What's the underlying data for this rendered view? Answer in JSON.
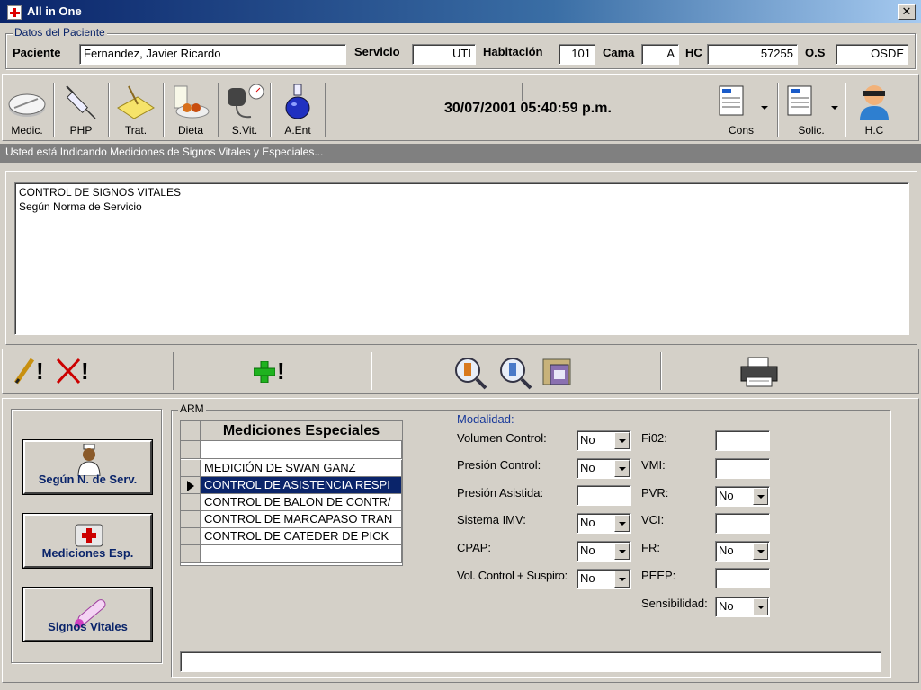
{
  "window": {
    "title": "All in One",
    "close_glyph": "✕"
  },
  "patient": {
    "legend": "Datos del Paciente",
    "paciente_label": "Paciente",
    "paciente_value": "Fernandez, Javier Ricardo",
    "servicio_label": "Servicio",
    "servicio_value": "UTI",
    "habitacion_label": "Habitación",
    "habitacion_value": "101",
    "cama_label": "Cama",
    "cama_value": "A",
    "hc_label": "HC",
    "hc_value": "57255",
    "os_label": "O.S",
    "os_value": "OSDE"
  },
  "toolbar": {
    "items": [
      {
        "label": "Medic.",
        "icon": "pill-icon"
      },
      {
        "label": "PHP",
        "icon": "syringe-icon"
      },
      {
        "label": "Trat.",
        "icon": "treatment-icon"
      },
      {
        "label": "Dieta",
        "icon": "diet-icon"
      },
      {
        "label": "S.Vit.",
        "icon": "blood-pressure-icon"
      },
      {
        "label": "A.Ent",
        "icon": "flask-icon"
      }
    ],
    "datetime": "30/07/2001 05:40:59 p.m.",
    "right_items": [
      {
        "label": "Cons",
        "icon": "document-icon"
      },
      {
        "label": "Solic.",
        "icon": "request-document-icon"
      },
      {
        "label": "H.C",
        "icon": "doctor-avatar-icon"
      }
    ]
  },
  "status": {
    "text": "Usted está Indicando Mediciones de Signos Vitales y Especiales..."
  },
  "memo": {
    "line1": "CONTROL DE SIGNOS VITALES",
    "line2": "Según Norma de Servicio"
  },
  "action_bar": {
    "edit_icon": "pencil-icon",
    "delete_icon": "delete-x-icon",
    "add_icon": "green-plus-icon",
    "search_icons": [
      "search-info-icon",
      "search-info-alt-icon"
    ],
    "folder_icon": "folder-icon",
    "print_icon": "printer-icon",
    "bang": "!"
  },
  "left_buttons": [
    {
      "label": "Según N. de Serv.",
      "icon": "nurse-icon"
    },
    {
      "label": "Mediciones Esp.",
      "icon": "first-aid-kit-icon"
    },
    {
      "label": "Signos Vitales",
      "icon": "thermometer-icon"
    }
  ],
  "arm": {
    "legend": "ARM",
    "grid_header": "Mediciones Especiales",
    "rows": [
      "",
      "MEDICIÓN DE SWAN GANZ",
      "CONTROL DE ASISTENCIA RESPI",
      "CONTROL DE BALON DE CONTR/",
      "CONTROL DE MARCAPASO TRAN",
      "CONTROL DE CATEDER DE PICK",
      ""
    ],
    "selected_row": 2,
    "modalidad_label": "Modalidad:",
    "left_fields": [
      {
        "label": "Volumen Control:",
        "type": "combo",
        "value": "No"
      },
      {
        "label": "Presión Control:",
        "type": "combo",
        "value": "No"
      },
      {
        "label": "Presión Asistida:",
        "type": "text",
        "value": ""
      },
      {
        "label": "Sistema IMV:",
        "type": "combo",
        "value": "No"
      },
      {
        "label": "CPAP:",
        "type": "combo",
        "value": "No"
      },
      {
        "label": "Vol. Control + Suspiro:",
        "type": "combo",
        "value": "No"
      }
    ],
    "right_fields": [
      {
        "label": "Fi02:",
        "type": "text",
        "value": ""
      },
      {
        "label": "VMI:",
        "type": "text",
        "value": ""
      },
      {
        "label": "PVR:",
        "type": "combo",
        "value": "No"
      },
      {
        "label": "VCI:",
        "type": "text",
        "value": ""
      },
      {
        "label": "FR:",
        "type": "combo",
        "value": "No"
      },
      {
        "label": "PEEP:",
        "type": "text",
        "value": ""
      },
      {
        "label": "Sensibilidad:",
        "type": "combo",
        "value": "No"
      }
    ],
    "bottom_text": ""
  }
}
